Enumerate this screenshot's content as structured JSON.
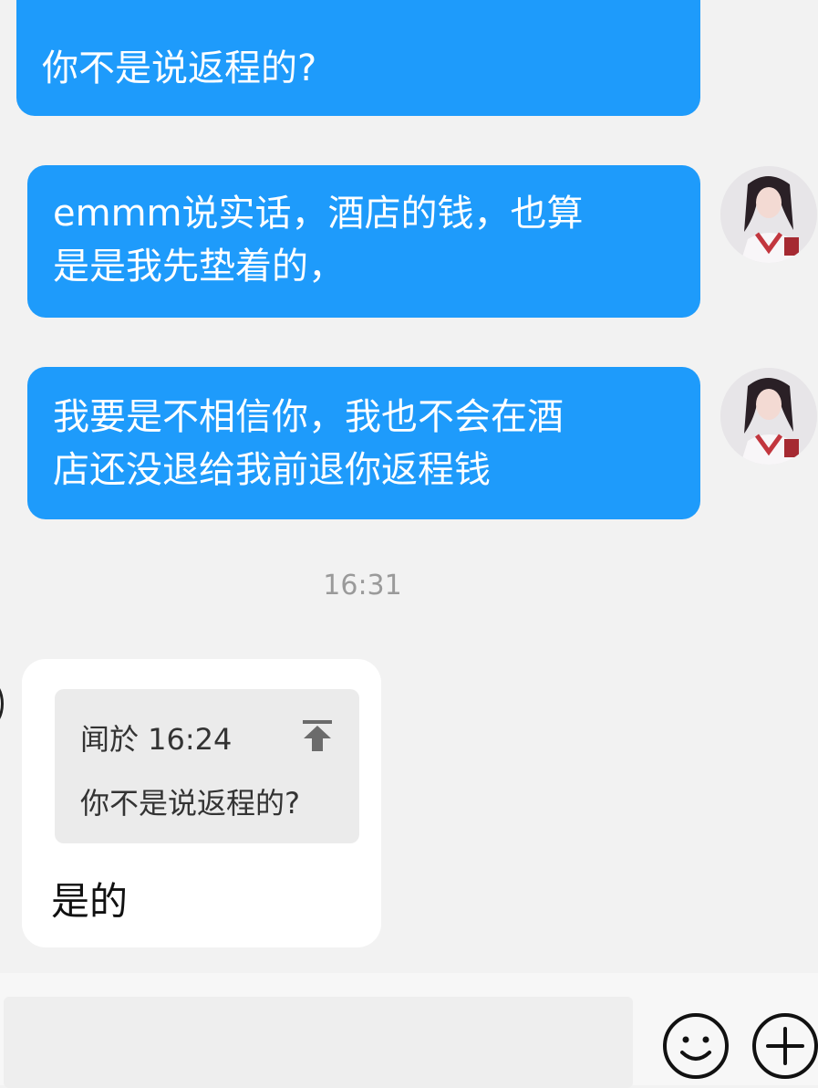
{
  "messages": {
    "out_quoted_partial": "你不是说返程的?",
    "out_1_line1": "emmm说实话，酒店的钱，也算",
    "out_1_line2": "是是我先垫着的，",
    "out_2_line1": "我要是不相信你，我也不会在酒",
    "out_2_line2": "店还没退给我前退你返程钱"
  },
  "timestamp": "16:31",
  "reply": {
    "quote_header": "闻於 16:24",
    "quote_text": "你不是说返程的?",
    "text": "是的"
  },
  "input": {
    "placeholder": "",
    "emoji_icon": "emoji-icon",
    "plus_icon": "plus-icon"
  },
  "colors": {
    "outgoing_bubble": "#1e9bfb",
    "background": "#f2f2f2"
  }
}
